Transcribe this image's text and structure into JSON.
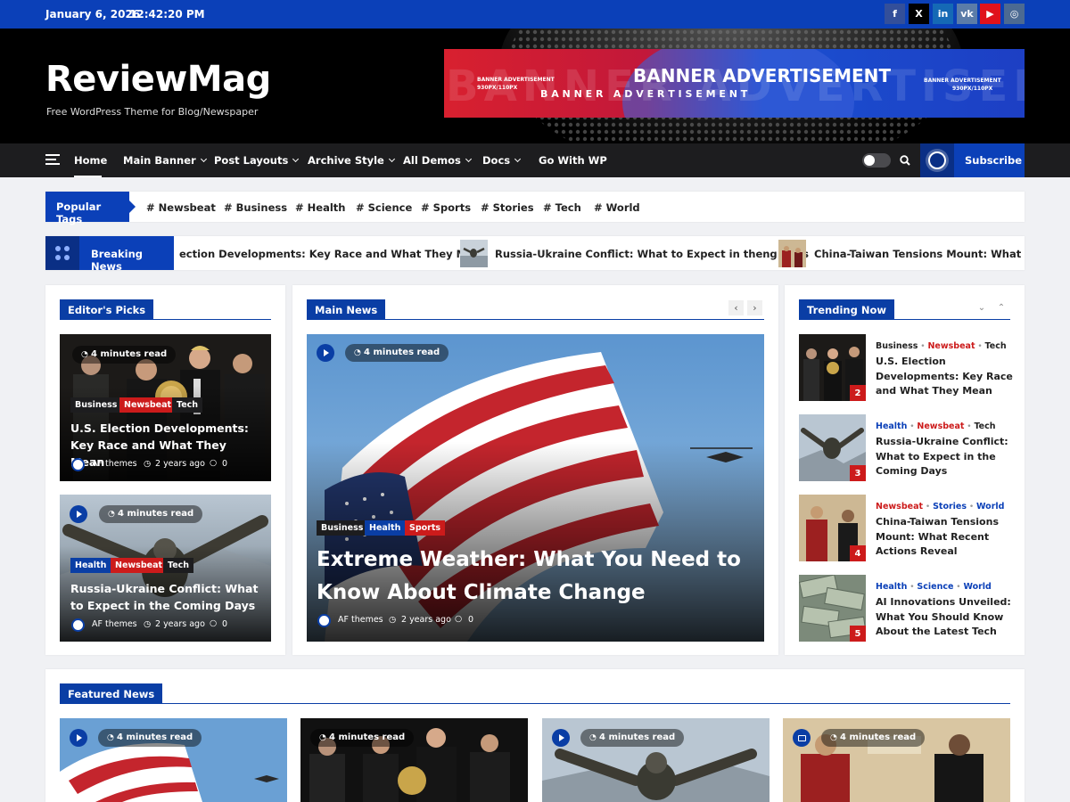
{
  "topbar": {
    "date": "January 6, 2026",
    "time": "12:42:20 PM"
  },
  "social": {
    "icons": [
      "facebook-icon",
      "x-icon",
      "linkedin-icon",
      "vk-icon",
      "youtube-icon",
      "instagram-icon"
    ],
    "glyphs": [
      "f",
      "X",
      "in",
      "vk",
      "▶",
      "◎"
    ]
  },
  "header": {
    "title": "ReviewMag",
    "description": "Free WordPress Theme for Blog/Newspaper"
  },
  "banner": {
    "main_text": "BANNER ADVERTISEMENT",
    "spaced_text": "B A N N E R   A D V E R T I S E M E N T",
    "left_small_1": "BANNER ADVERTISEMENT",
    "left_small_2": "930PX/110PX",
    "right_small_1": "BANNER ADVERTISEMENT",
    "right_small_2": "930PX/110PX"
  },
  "nav": {
    "items": [
      "Home",
      "Main Banner",
      "Post Layouts",
      "Archive Style",
      "All Demos",
      "Docs",
      "Go With WP"
    ],
    "subscribe": "Subscribe"
  },
  "tags": {
    "label": "Popular Tags",
    "items": [
      "# Newsbeat",
      "# Business",
      "# Health",
      "# Science",
      "# Sports",
      "# Stories",
      "# Tech",
      "# World"
    ]
  },
  "breaking": {
    "label": "Breaking News",
    "items": [
      "ection Developments: Key Race and What They Mean",
      "Russia-Ukraine Conflict: What to Expect in theng Days",
      "China-Taiwan Tensions Mount: What Recer"
    ]
  },
  "editors": {
    "heading": "Editor's Picks",
    "posts": [
      {
        "read": "4 minutes read",
        "cats": [
          "Business",
          "Newsbeat",
          "Tech"
        ],
        "title": "U.S. Election Developments: Key Race and What They Mean",
        "author": "AF themes",
        "time": "2 years ago",
        "comments": "0"
      },
      {
        "read": "4 minutes read",
        "cats": [
          "Health",
          "Newsbeat",
          "Tech"
        ],
        "title": "Russia-Ukraine Conflict: What to Expect in the Coming Days",
        "author": "AF themes",
        "time": "2 years ago",
        "comments": "0"
      }
    ]
  },
  "main_news": {
    "heading": "Main News",
    "post": {
      "read": "4 minutes read",
      "cats": [
        "Business",
        "Health",
        "Sports"
      ],
      "title": "Extreme Weather: What You Need to Know About Climate Change",
      "author": "AF themes",
      "time": "2 years ago",
      "comments": "0"
    }
  },
  "trending": {
    "heading": "Trending Now",
    "items": [
      {
        "cats": [
          "Business",
          "Newsbeat",
          "Tech"
        ],
        "title": "U.S. Election Developments: Key Race and What They Mean",
        "num": "2"
      },
      {
        "cats": [
          "Health",
          "Newsbeat",
          "Tech"
        ],
        "title": "Russia-Ukraine Conflict: What to Expect in the Coming Days",
        "num": "3"
      },
      {
        "cats": [
          "Newsbeat",
          "Stories",
          "World"
        ],
        "title": "China-Taiwan Tensions Mount: What Recent Actions Reveal",
        "num": "4"
      },
      {
        "cats": [
          "Health",
          "Science",
          "World"
        ],
        "title": "AI Innovations Unveiled: What You Should Know About the Latest Tech",
        "num": "5"
      }
    ]
  },
  "featured": {
    "heading": "Featured News",
    "cards": [
      {
        "read": "4 minutes read"
      },
      {
        "read": "4 minutes read"
      },
      {
        "read": "4 minutes read"
      },
      {
        "read": "4 minutes read"
      }
    ]
  },
  "colors": {
    "primary": "#0b40b8",
    "accent": "#cc1b1b",
    "nav": "#1d1d1f"
  }
}
